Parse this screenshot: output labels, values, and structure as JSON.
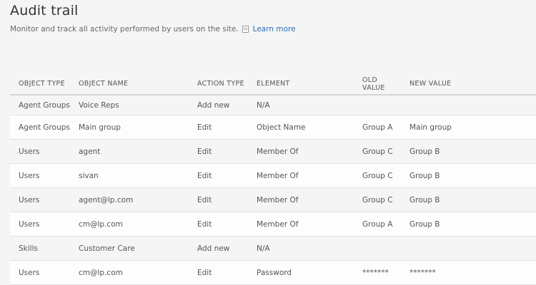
{
  "header": {
    "title": "Audit trail",
    "description": "Monitor and track all activity performed by users on the site.",
    "learn_more": "Learn more",
    "icon": "document-icon"
  },
  "table": {
    "columns": [
      "OBJECT TYPE",
      "OBJECT NAME",
      "ACTION TYPE",
      "ELEMENT",
      "OLD VALUE",
      "NEW VALUE"
    ],
    "rows": [
      [
        "Agent Groups",
        "Voice Reps",
        "Add new",
        "N/A",
        "",
        ""
      ],
      [
        "Agent Groups",
        "Main group",
        "Edit",
        "Object Name",
        "Group A",
        "Main group"
      ],
      [
        "Users",
        "agent",
        "Edit",
        "Member Of",
        "Group C",
        "Group B"
      ],
      [
        "Users",
        "sivan",
        "Edit",
        "Member Of",
        "Group C",
        "Group B"
      ],
      [
        "Users",
        "agent@lp.com",
        "Edit",
        "Member Of",
        "Group C",
        "Group B"
      ],
      [
        "Users",
        "cm@lp.com",
        "Edit",
        "Member Of",
        "Group A",
        "Group B"
      ],
      [
        "Skills",
        "Customer Care",
        "Add new",
        "N/A",
        "",
        ""
      ],
      [
        "Users",
        "cm@lp.com",
        "Edit",
        "Password",
        "*******",
        "*******"
      ]
    ]
  }
}
